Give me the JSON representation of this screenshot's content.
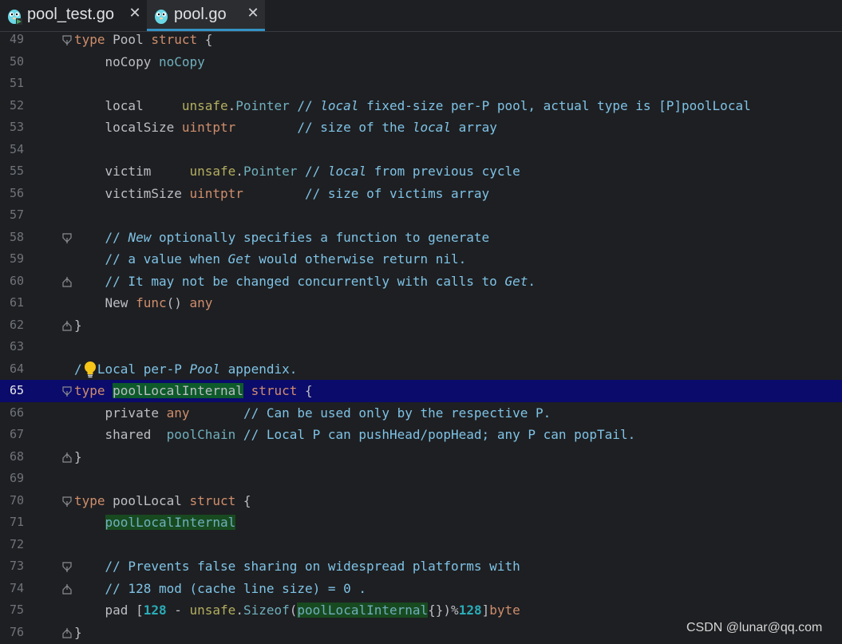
{
  "tabs": [
    {
      "label": "pool_test.go",
      "active": false
    },
    {
      "label": "pool.go",
      "active": true
    }
  ],
  "editor": {
    "current_line": "65",
    "lines": [
      {
        "num": "49",
        "fold": "start"
      },
      {
        "num": "50"
      },
      {
        "num": "51"
      },
      {
        "num": "52"
      },
      {
        "num": "53"
      },
      {
        "num": "54"
      },
      {
        "num": "55"
      },
      {
        "num": "56"
      },
      {
        "num": "57"
      },
      {
        "num": "58",
        "fold": "start"
      },
      {
        "num": "59"
      },
      {
        "num": "60",
        "fold": "end"
      },
      {
        "num": "61"
      },
      {
        "num": "62",
        "fold": "end"
      },
      {
        "num": "63"
      },
      {
        "num": "64"
      },
      {
        "num": "65",
        "fold": "start"
      },
      {
        "num": "66"
      },
      {
        "num": "67"
      },
      {
        "num": "68",
        "fold": "end"
      },
      {
        "num": "69"
      },
      {
        "num": "70",
        "fold": "start"
      },
      {
        "num": "71"
      },
      {
        "num": "72"
      },
      {
        "num": "73",
        "fold": "start"
      },
      {
        "num": "74",
        "fold": "end"
      },
      {
        "num": "75"
      },
      {
        "num": "76",
        "fold": "end"
      }
    ],
    "code": {
      "l49": {
        "kw1": "type",
        "name": " Pool ",
        "kw2": "struct",
        "rest": " {"
      },
      "l50": {
        "field": "    noCopy ",
        "type": "noCopy"
      },
      "l52": {
        "field": "    local     ",
        "pkg": "unsafe",
        "dot": ".",
        "type": "Pointer",
        "c1": " // ",
        "ci": "local",
        "c2": " fixed-size per-P pool, actual type is [P]poolLocal"
      },
      "l53": {
        "field": "    localSize ",
        "type": "uintptr",
        "sp": "        ",
        "c1": "// size of the ",
        "ci": "local",
        "c2": " array"
      },
      "l55": {
        "field": "    victim     ",
        "pkg": "unsafe",
        "dot": ".",
        "type": "Pointer",
        "c1": " // ",
        "ci": "local",
        "c2": " from previous cycle"
      },
      "l56": {
        "field": "    victimSize ",
        "type": "uintptr",
        "sp": "        ",
        "c1": "// size of victims array"
      },
      "l58": {
        "c1": "    // ",
        "ci": "New",
        "c2": " optionally specifies a function to generate"
      },
      "l59": {
        "c1": "    // a value when ",
        "ci": "Get",
        "c2": " would otherwise return nil."
      },
      "l60": {
        "c1": "    // It may not be changed concurrently with calls to ",
        "ci": "Get",
        "c2": "."
      },
      "l61": {
        "field": "    New ",
        "fn": "func",
        "paren": "() ",
        "type": "any"
      },
      "l62": {
        "rest": "}"
      },
      "l64": {
        "c1": "/",
        "c2": "Local per-P ",
        "ci": "Pool",
        "c3": " appendix."
      },
      "l65": {
        "kw1": "type",
        "sp": " ",
        "name": "poolLocalInternal",
        "sp2": " ",
        "kw2": "struct",
        "rest": " {"
      },
      "l66": {
        "field": "    private ",
        "type": "any",
        "sp": "       ",
        "c1": "// Can be used only by the respective P."
      },
      "l67": {
        "field": "    shared  ",
        "type": "poolChain",
        "c1": " // Local P can pushHead/popHead; any P can popTail."
      },
      "l68": {
        "rest": "}"
      },
      "l70": {
        "kw1": "type",
        "name": " poolLocal ",
        "kw2": "struct",
        "rest": " {"
      },
      "l71": {
        "ind": "    ",
        "type": "poolLocalInternal"
      },
      "l73": {
        "c1": "    // Prevents false sharing on widespread platforms with"
      },
      "l74": {
        "c1": "    // 128 mod (cache line size) = 0 ."
      },
      "l75": {
        "field": "    pad ",
        "b1": "[",
        "n1": "128",
        "op": " - ",
        "pkg": "unsafe",
        "dot": ".",
        "fn": "Sizeof",
        "p1": "(",
        "type": "poolLocalInternal",
        "p2": "{})%",
        "n2": "128",
        "b2": "]",
        "bt": "byte"
      },
      "l76": {
        "rest": "}"
      }
    }
  },
  "watermark": "CSDN @lunar@qq.com",
  "colors": {
    "background": "#1e1f22",
    "current_line": "#0b0b6b",
    "keyword": "#cf8e6d",
    "type": "#6fafbd",
    "comment": "#7ec3e6",
    "number": "#2aacb8",
    "tab_underline": "#3592c4"
  },
  "icons": [
    "gopher-file-icon",
    "close-icon",
    "fold-marker-icon",
    "lightbulb-icon"
  ]
}
